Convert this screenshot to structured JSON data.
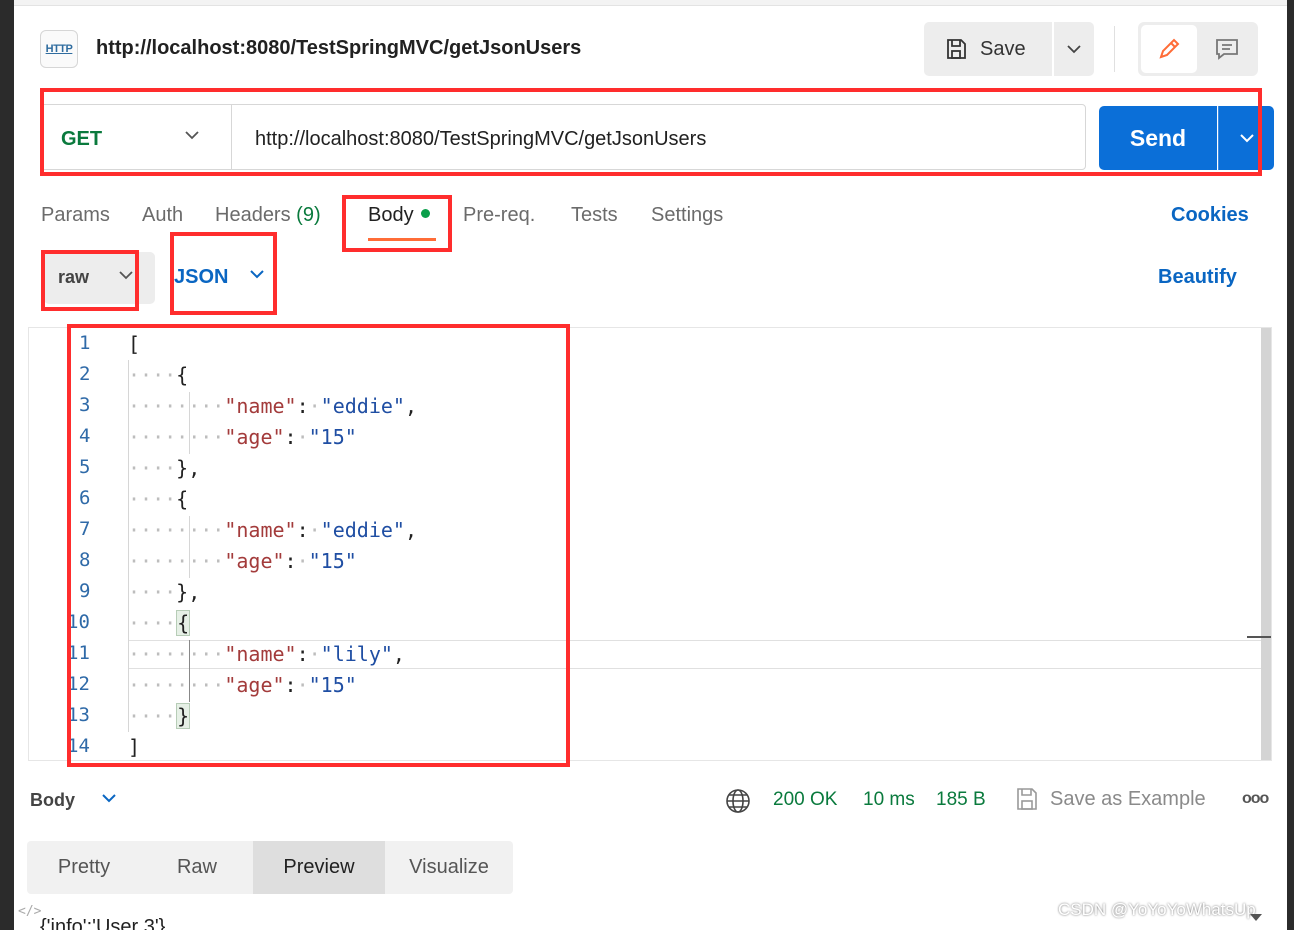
{
  "header": {
    "icon_label": "HTTP",
    "title": "http://localhost:8080/TestSpringMVC/getJsonUsers",
    "save_label": "Save"
  },
  "request": {
    "method": "GET",
    "url": "http://localhost:8080/TestSpringMVC/getJsonUsers",
    "send_label": "Send"
  },
  "tabs": {
    "params": "Params",
    "auth": "Auth",
    "headers": "Headers",
    "headers_count": "(9)",
    "body": "Body",
    "prereq": "Pre-req.",
    "tests": "Tests",
    "settings": "Settings",
    "cookies": "Cookies"
  },
  "body_toolbar": {
    "mode": "raw",
    "language": "JSON",
    "beautify": "Beautify"
  },
  "editor": {
    "line_numbers": [
      "1",
      "2",
      "3",
      "4",
      "5",
      "6",
      "7",
      "8",
      "9",
      "10",
      "11",
      "12",
      "13",
      "14"
    ],
    "lines": {
      "l1": "[",
      "l2_open": "{",
      "l3_key": "\"name\"",
      "l3_val": "\"eddie\"",
      "l4_key": "\"age\"",
      "l4_val": "\"15\"",
      "l5_close": "},",
      "l6_open": "{",
      "l7_key": "\"name\"",
      "l7_val": "\"eddie\"",
      "l8_key": "\"age\"",
      "l8_val": "\"15\"",
      "l9_close": "},",
      "l10_open": "{",
      "l11_key": "\"name\"",
      "l11_val": "\"lily\"",
      "l12_key": "\"age\"",
      "l12_val": "\"15\"",
      "l13_close": "}",
      "l14": "]"
    }
  },
  "response": {
    "label": "Body",
    "status": "200 OK",
    "time": "10 ms",
    "size": "185 B",
    "save_example": "Save as Example",
    "more": "ooo",
    "view_tabs": [
      "Pretty",
      "Raw",
      "Preview",
      "Visualize"
    ],
    "active_view": "Preview",
    "preview_text": "{'info':'User 3'}"
  },
  "watermark": "CSDN @YoYoYoWhatsUp",
  "colors": {
    "send": "#0b6fd8",
    "method_get": "#0a7a3d",
    "link": "#0a66c2",
    "annotation": "#ff2d2d",
    "tab_underline": "#ff6c37"
  },
  "icons": [
    "http-icon",
    "save-icon",
    "chevron-down-icon",
    "pencil-icon",
    "comment-icon",
    "globe-icon",
    "save-example-icon",
    "code-icon"
  ]
}
